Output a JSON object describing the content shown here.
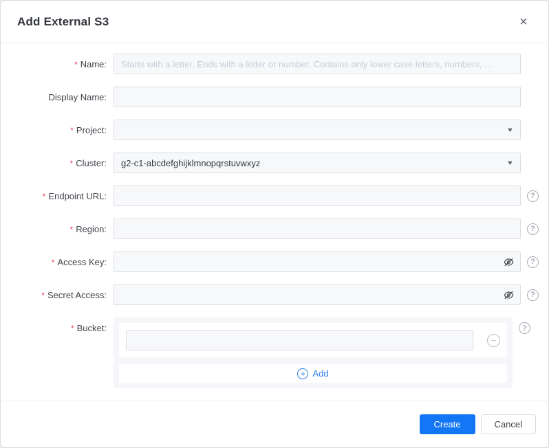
{
  "dialog": {
    "title": "Add External S3"
  },
  "required_marker": "*",
  "icons": {
    "close": "×",
    "help": "?",
    "minus": "−",
    "plus": "+",
    "caret": "▼"
  },
  "form": {
    "name": {
      "label": "Name:",
      "value": "",
      "placeholder": "Starts with a letter. Ends with a letter or number. Contains only lower case letters, numbers, ..."
    },
    "display_name": {
      "label": "Display Name:",
      "value": "",
      "placeholder": ""
    },
    "project": {
      "label": "Project:",
      "value": ""
    },
    "cluster": {
      "label": "Cluster:",
      "value": "g2-c1-abcdefghijklmnopqrstuvwxyz"
    },
    "endpoint_url": {
      "label": "Endpoint URL:",
      "value": ""
    },
    "region": {
      "label": "Region:",
      "value": ""
    },
    "access_key": {
      "label": "Access Key:",
      "value": ""
    },
    "secret_access": {
      "label": "Secret Access:",
      "value": ""
    },
    "bucket": {
      "label": "Bucket:",
      "items": [
        {
          "value": ""
        }
      ],
      "add_label": "Add"
    }
  },
  "footer": {
    "create_label": "Create",
    "cancel_label": "Cancel"
  },
  "colors": {
    "accent_blue": "#1276f5",
    "link_blue": "#2b7ce9",
    "required_red": "#e8455a",
    "input_bg": "#f7f8fa",
    "input_border": "#dadee4",
    "panel_bg": "#f4f6f9"
  }
}
